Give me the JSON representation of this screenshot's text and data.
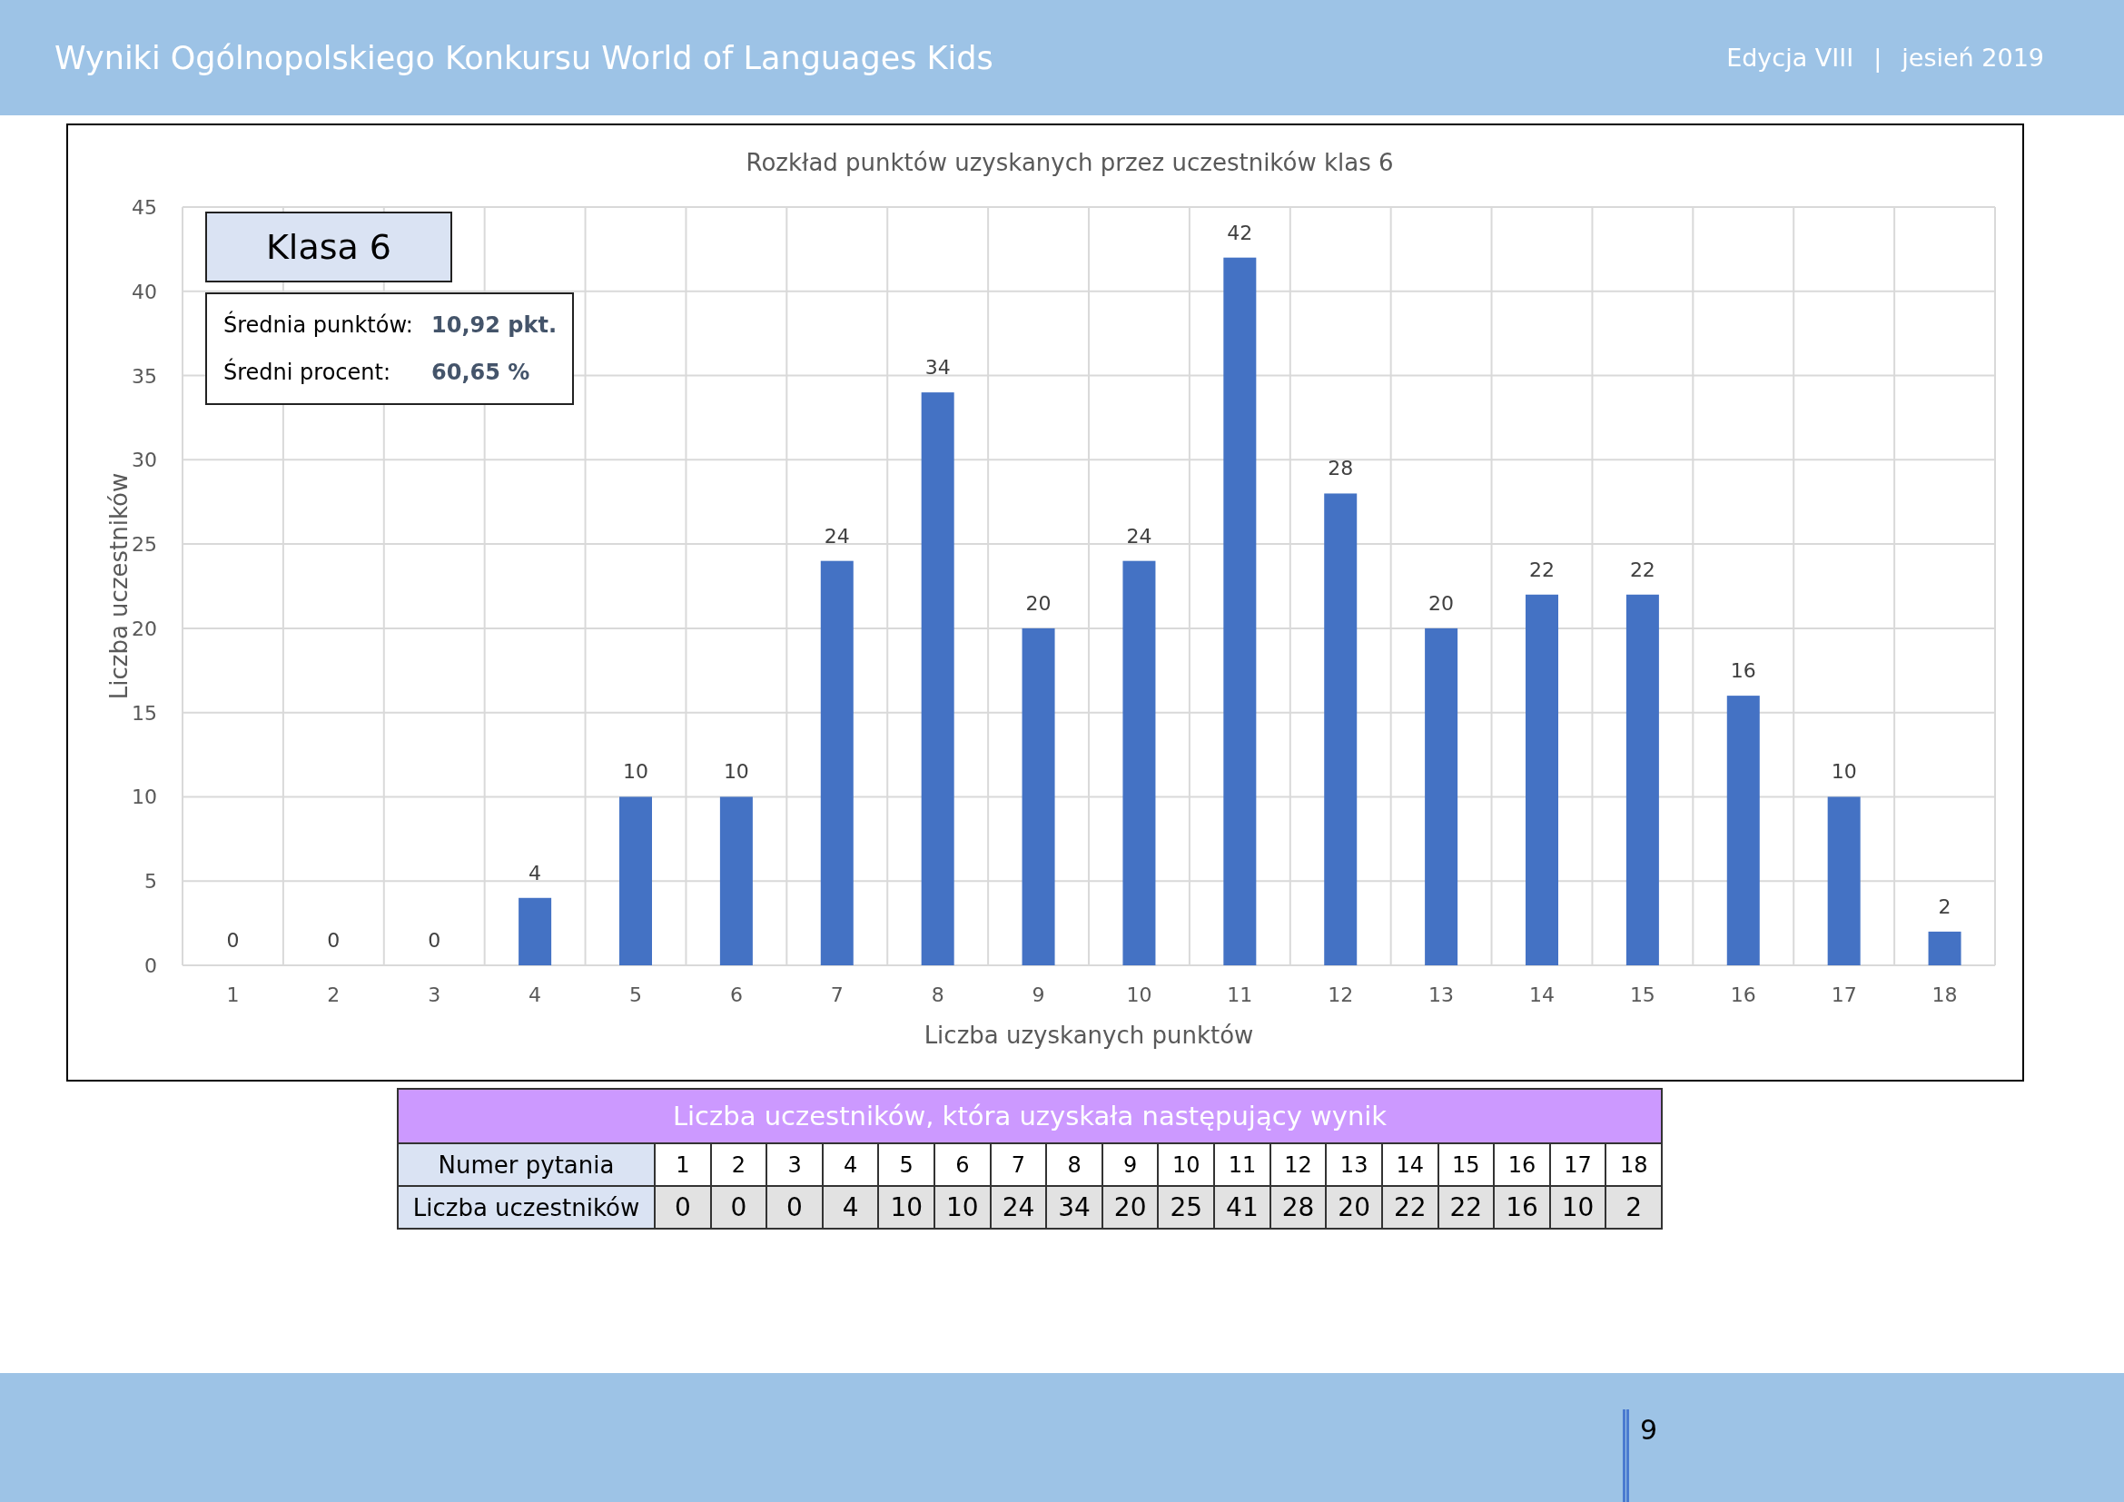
{
  "header": {
    "title": "Wyniki Ogólnopolskiego Konkursu World of Languages Kids",
    "edition": "Edycja VIII",
    "separator": "|",
    "season": "jesień 2019"
  },
  "chart": {
    "badge": "Klasa 6",
    "stats": [
      {
        "label": "Średnia punktów:",
        "value": "10,92 pkt."
      },
      {
        "label": "Średni procent:",
        "value": "60,65 %"
      }
    ],
    "chart_data": {
      "type": "bar",
      "title": "Rozkład punktów uzyskanych przez uczestników klas 6",
      "xlabel": "Liczba uzyskanych punktów",
      "ylabel": "Liczba uczestników",
      "categories": [
        "1",
        "2",
        "3",
        "4",
        "5",
        "6",
        "7",
        "8",
        "9",
        "10",
        "11",
        "12",
        "13",
        "14",
        "15",
        "16",
        "17",
        "18"
      ],
      "values": [
        0,
        0,
        0,
        4,
        10,
        10,
        24,
        34,
        20,
        24,
        42,
        28,
        20,
        22,
        22,
        16,
        10,
        2
      ],
      "ylim": [
        0,
        45
      ],
      "grid": true,
      "yticks": [
        0,
        5,
        10,
        15,
        20,
        25,
        30,
        35,
        40,
        45
      ],
      "data_labels": true
    }
  },
  "table": {
    "title": "Liczba uczestników, która uzyskała następujący wynik",
    "rows": [
      {
        "kind": "header",
        "label": "Numer pytania",
        "cells": [
          "1",
          "2",
          "3",
          "4",
          "5",
          "6",
          "7",
          "8",
          "9",
          "10",
          "11",
          "12",
          "13",
          "14",
          "15",
          "16",
          "17",
          "18"
        ]
      },
      {
        "kind": "data",
        "label": "Liczba uczestników",
        "cells": [
          "0",
          "0",
          "0",
          "4",
          "10",
          "10",
          "24",
          "34",
          "20",
          "25",
          "41",
          "28",
          "20",
          "22",
          "22",
          "16",
          "10",
          "2"
        ]
      }
    ]
  },
  "footer": {
    "page": "9"
  }
}
